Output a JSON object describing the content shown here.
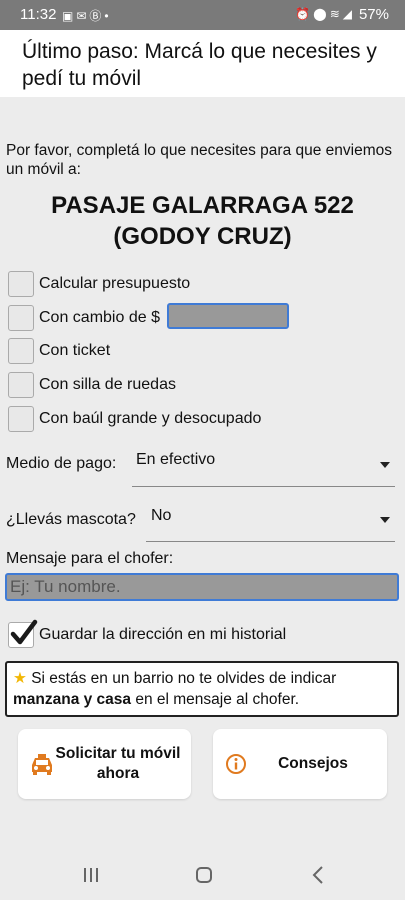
{
  "status_bar": {
    "time": "11:32",
    "battery": "57%",
    "notification_icons": [
      "image-icon",
      "mail-icon",
      "b-icon",
      "dot-icon"
    ],
    "system_icons": [
      "alarm-icon",
      "location-icon",
      "wifi-icon",
      "signal-icon"
    ]
  },
  "header": {
    "title": "Último paso: Marcá lo que necesites y pedí tu móvil"
  },
  "intro": "Por favor, completá lo que necesites para que enviemos un móvil a:",
  "address": {
    "line1": "PASAJE GALARRAGA 522",
    "line2": "(GODOY CRUZ)"
  },
  "options": [
    {
      "label": "Calcular presupuesto",
      "checked": false
    },
    {
      "label": "Con cambio de $",
      "checked": false
    },
    {
      "label": "Con ticket",
      "checked": false
    },
    {
      "label": "Con silla de ruedas",
      "checked": false
    },
    {
      "label": "Con baúl grande y desocupado",
      "checked": false
    }
  ],
  "change_amount": "",
  "payment": {
    "label": "Medio de pago:",
    "value": "En efectivo"
  },
  "pet": {
    "label": "¿Llevás mascota?",
    "value": "No"
  },
  "message": {
    "label": "Mensaje para el chofer:",
    "placeholder": "Ej: Tu nombre.",
    "value": ""
  },
  "save_history": {
    "label": "Guardar la dirección en mi historial",
    "checked": true
  },
  "tip": {
    "part1": "Si estás en un barrio no te olvides de indicar ",
    "bold": "manzana y casa",
    "part2": " en el mensaje al chofer."
  },
  "buttons": {
    "request_line1": "Solicitar tu móvil",
    "request_line2": "ahora",
    "advice": "Consejos"
  },
  "colors": {
    "accent_blue": "#3f7bd6",
    "icon_orange": "#e07a1f",
    "star_yellow": "#f2b705",
    "status_bar": "#7a7a7a"
  }
}
